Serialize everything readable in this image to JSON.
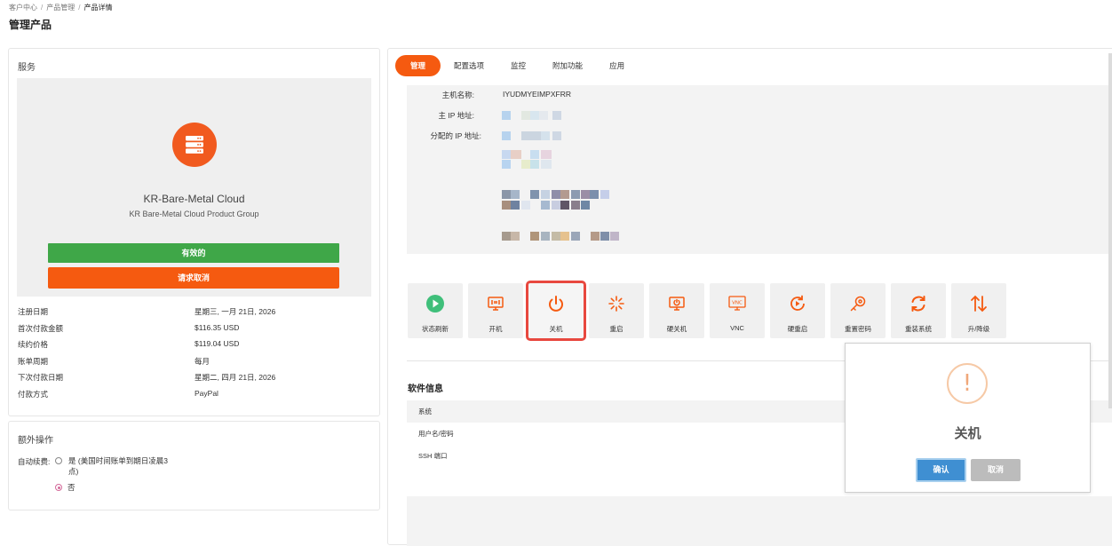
{
  "breadcrumb": {
    "home": "客户中心",
    "products": "产品管理",
    "current": "产品详情"
  },
  "page_title": "管理产品",
  "service": {
    "heading": "服务",
    "product_name": "KR-Bare-Metal Cloud",
    "product_group": "KR Bare-Metal Cloud Product Group",
    "status_button": "有效的",
    "cancel_request_button": "请求取消",
    "info": [
      {
        "key": "注册日期",
        "value": "星期三, 一月 21日, 2026"
      },
      {
        "key": "首次付款金额",
        "value": "$116.35 USD"
      },
      {
        "key": "续约价格",
        "value": "$119.04 USD"
      },
      {
        "key": "账单周期",
        "value": "每月"
      },
      {
        "key": "下次付款日期",
        "value": "星期二, 四月 21日, 2026"
      },
      {
        "key": "付款方式",
        "value": "PayPal"
      }
    ]
  },
  "extra": {
    "heading": "额外操作",
    "auto_renew_label": "自动续费:",
    "option_yes": "是 (美国时间账单到期日凌晨3点)",
    "option_no": "否",
    "selected": "否"
  },
  "tabs": [
    {
      "label": "管理",
      "active": true
    },
    {
      "label": "配置选项",
      "active": false
    },
    {
      "label": "监控",
      "active": false
    },
    {
      "label": "附加功能",
      "active": false
    },
    {
      "label": "应用",
      "active": false
    }
  ],
  "host": {
    "hostname_label": "主机名称:",
    "hostname_value": "IYUDMYEIMPXFRR",
    "main_ip_label": "主 IP 地址:",
    "assigned_ip_label": "分配的 IP 地址:"
  },
  "actions": [
    {
      "label": "状态刷新",
      "icon": "play-circle-icon"
    },
    {
      "label": "开机",
      "icon": "power-on-icon"
    },
    {
      "label": "关机",
      "icon": "power-off-icon",
      "highlighted": true
    },
    {
      "label": "重启",
      "icon": "reboot-icon"
    },
    {
      "label": "硬关机",
      "icon": "hard-shutdown-icon"
    },
    {
      "label": "VNC",
      "icon": "vnc-icon"
    },
    {
      "label": "硬重启",
      "icon": "hard-reboot-icon"
    },
    {
      "label": "重置密码",
      "icon": "reset-password-icon"
    },
    {
      "label": "重装系统",
      "icon": "reinstall-icon"
    },
    {
      "label": "升/降级",
      "icon": "upgrade-downgrade-icon"
    }
  ],
  "software": {
    "title": "软件信息",
    "rows": [
      "系统",
      "用户名/密码",
      "SSH 端口"
    ]
  },
  "dialog": {
    "title": "关机",
    "confirm": "确认",
    "cancel": "取消"
  },
  "colors": {
    "accent": "#f55a10",
    "success": "#3fa748",
    "primary": "#3f8fd2"
  }
}
